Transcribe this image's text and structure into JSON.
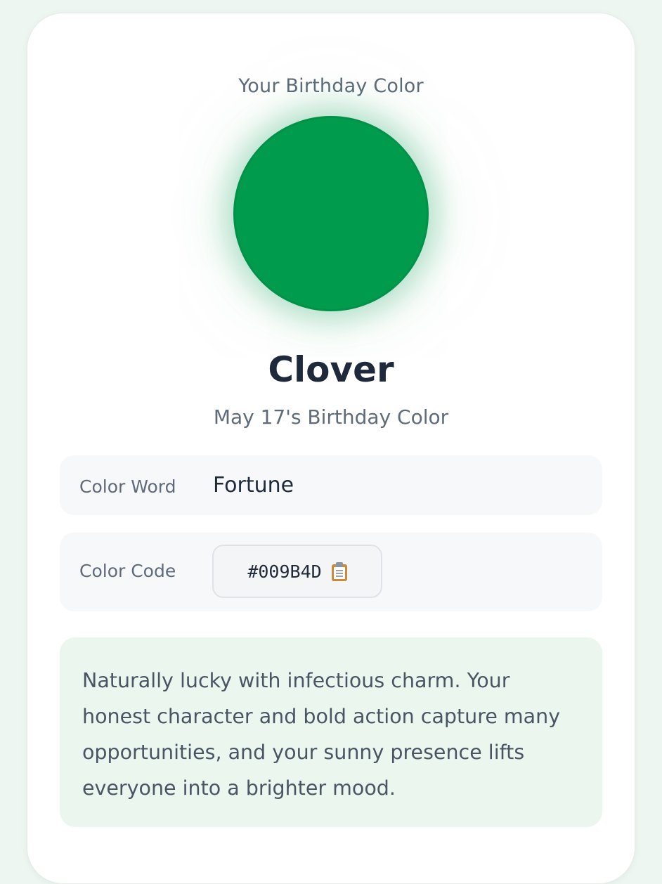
{
  "header": {
    "subtitle": "Your Birthday Color"
  },
  "swatch": {
    "color": "#009B4D",
    "glow_color": "#009B4D"
  },
  "color": {
    "name": "Clover",
    "date_line": "May 17's Birthday Color"
  },
  "details": {
    "word_label": "Color Word",
    "word_value": "Fortune",
    "code_label": "Color Code",
    "code_value": "#009B4D",
    "copy_icon": "clipboard-icon"
  },
  "description": {
    "text": "Naturally lucky with infectious charm. Your honest character and bold action capture many opportunities, and your sunny presence lifts everyone into a brighter mood."
  },
  "theme": {
    "page_background": "#eef6f1",
    "card_background": "#ffffff",
    "description_background": "#ebf6ef"
  }
}
